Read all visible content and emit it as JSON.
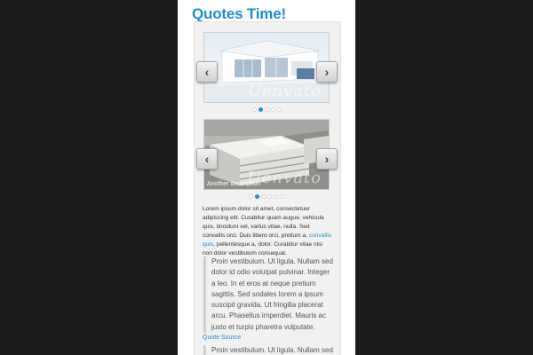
{
  "page": {
    "title": "Quotes Time!"
  },
  "slider1": {
    "watermark": "Uenvato",
    "dot_count": 5,
    "active_dot": 1
  },
  "slider2": {
    "watermark": "Uenvato",
    "caption": "Another description",
    "dot_count": 6,
    "active_dot": 1
  },
  "nav": {
    "prev_icon": "‹",
    "next_icon": "›"
  },
  "paragraph": {
    "text_before": "Lorem ipsum dolor sit amet, consectetuer adipiscing elit. Curabitur quam augue, vehicula quis, tincidunt vel, varius vitae, nulla. Sed convallis orci. Duis libero orci, pretium a, ",
    "link": "convallis quis",
    "text_after": ", pellentesque a, dolor. Curabitur vitae nisi non dolor vestibulum consequat."
  },
  "quote1": {
    "text": "Proin vestibulum. Ut ligula. Nullam sed dolor id odio volutpat pulvinar. Integer a leo. In et eros at neque pretium sagittis. Sed sodales lorem a ipsum suscipit gravida. Ut fringilla placerat arcu. Phasellus imperdiet. Mauris ac justo et turpis pharetra vulputate."
  },
  "quote_source": "Quote Source",
  "quote2": {
    "text": "Proin vestibulum. Ut ligula. Nullam sed"
  },
  "colors": {
    "accent": "#1a8fd1",
    "background": "#1b1b1b",
    "panel": "#f1f1f1"
  }
}
